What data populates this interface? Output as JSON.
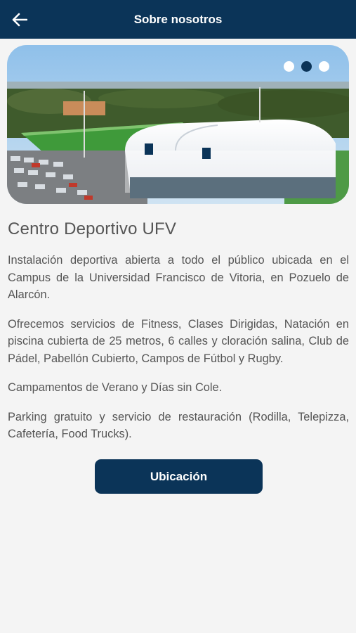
{
  "appbar": {
    "title": "Sobre nosotros",
    "back_icon": "arrow-left-icon"
  },
  "carousel": {
    "slide_count": 3,
    "active_index": 1,
    "image_subject": "aerial photo of sports center"
  },
  "content": {
    "heading": "Centro Deportivo UFV",
    "paragraphs": [
      "Instalación deportiva abierta a todo el público ubicada en el Campus de la Universidad Francisco de Vitoria, en Pozuelo de Alarcón.",
      "Ofrecemos servicios de Fitness, Clases Dirigidas, Natación en piscina cubierta de 25 metros, 6 calles y cloración salina, Club de Pádel, Pabellón Cubierto, Campos de Fútbol y Rugby.",
      "Campamentos de Verano y Días sin Cole.",
      "Parking gratuito y servicio de restauración (Rodilla, Telepizza, Cafetería, Food Trucks)."
    ]
  },
  "location_button": {
    "label": "Ubicación"
  },
  "colors": {
    "primary": "#0b3458",
    "text": "#555555",
    "background": "#f4f4f4"
  }
}
